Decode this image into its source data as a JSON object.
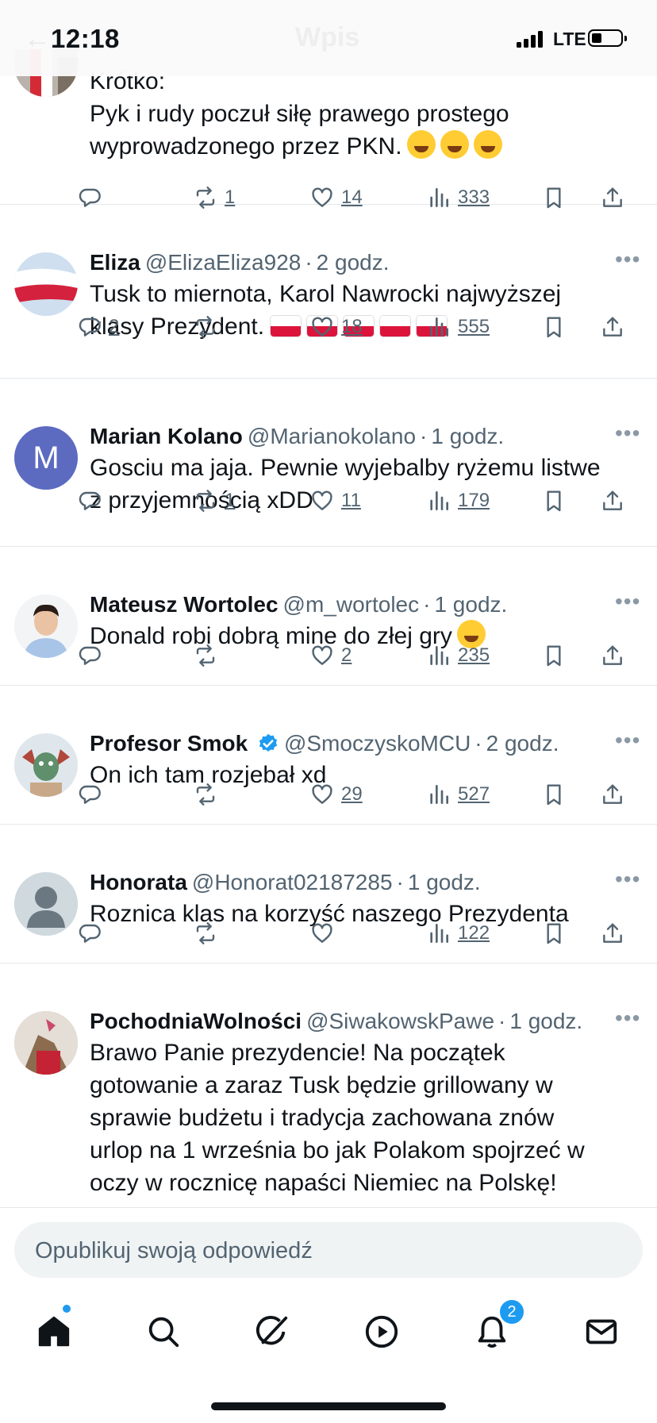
{
  "status_bar": {
    "time": "12:18",
    "network": "LTE",
    "ghost_title": "Wpis",
    "ghost_back": "←"
  },
  "colors": {
    "accent": "#1d9bf0",
    "text": "#0f1419",
    "secondary": "#536471",
    "verified": "#1d9bf0"
  },
  "tweets": [
    {
      "name": "",
      "handle": "",
      "time": "",
      "text": "Krótko:\nPyk i rudy poczuł  siłę prawego prostego\nwyprowadzonego przez PKN.",
      "replies": "",
      "retweets": "1",
      "likes": "14",
      "views": "333"
    },
    {
      "name": "Eliza",
      "handle": "@ElizaEliza928",
      "time": "2 godz.",
      "text": "Tusk to miernota, Karol Nawrocki najwyższej\nklasy Prezydent.",
      "replies": "2",
      "retweets": "",
      "likes": "18",
      "views": "555"
    },
    {
      "name": "Marian Kolano",
      "handle": "@Marianokolano",
      "time": "1 godz.",
      "avatar_letter": "M",
      "text": "Gosciu ma jaja. Pewnie wyjebalby ryżemu listwe\nz przyjemnością xDD",
      "replies": "",
      "retweets": "1",
      "likes": "11",
      "views": "179"
    },
    {
      "name": "Mateusz Wortolec",
      "handle": "@m_wortolec",
      "time": "1 godz.",
      "text": "Donald robi dobrą mine do złej gry",
      "replies": "",
      "retweets": "",
      "likes": "2",
      "views": "235"
    },
    {
      "name": "Profesor Smok",
      "handle": "@SmoczyskoMCU",
      "time": "2 godz.",
      "text": "On ich tam rozjebał xd",
      "replies": "",
      "retweets": "",
      "likes": "29",
      "views": "527"
    },
    {
      "name": "Honorata",
      "handle": "@Honorat02187285",
      "time": "1 godz.",
      "text": "Roznica klas na korzyść naszego Prezydenta",
      "replies": "",
      "retweets": "",
      "likes": "",
      "views": "122"
    },
    {
      "name": "PochodniaWolności",
      "handle": "@SiwakowskPawe",
      "time": "1 godz.",
      "text": "Brawo Panie prezydencie! Na początek\ngotowanie a zaraz Tusk będzie grillowany w\nsprawie budżetu i tradycja zachowana znów\nurlop na 1 września bo jak Polakom spojrzeć w\noczy w rocznicę napaści Niemiec na Polskę!"
    }
  ],
  "reply_box": {
    "placeholder": "Opublikuj swoją odpowiedź"
  },
  "tab_bar": {
    "items": [
      "home-icon",
      "search-icon",
      "grok-icon",
      "video-icon",
      "notifications-icon",
      "messages-icon"
    ],
    "notifications_badge": "2"
  }
}
